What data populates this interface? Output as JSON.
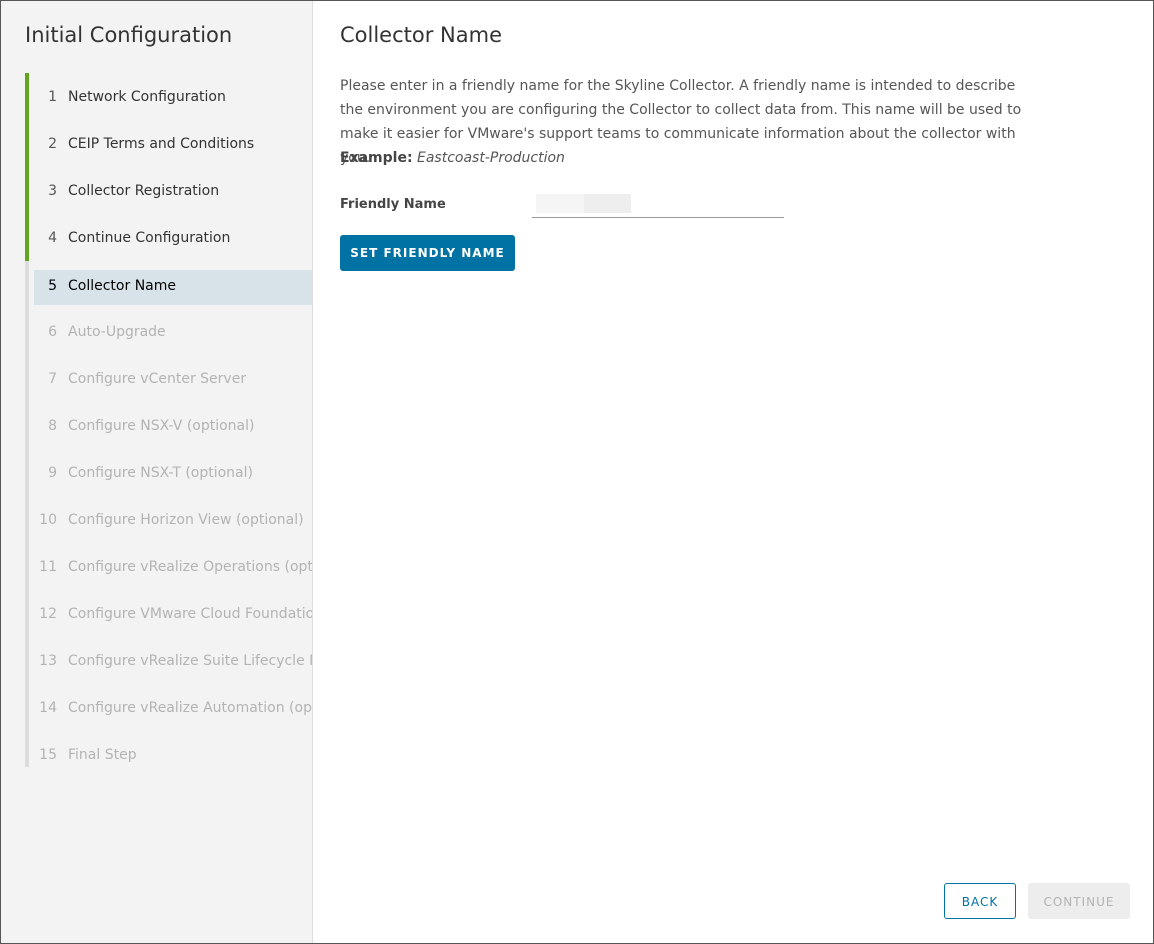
{
  "sidebar": {
    "title": "Initial Configuration",
    "steps": [
      {
        "num": "1",
        "label": "Network Configuration",
        "state": "done"
      },
      {
        "num": "2",
        "label": "CEIP Terms and Conditions",
        "state": "done"
      },
      {
        "num": "3",
        "label": "Collector Registration",
        "state": "done"
      },
      {
        "num": "4",
        "label": "Continue Configuration",
        "state": "done"
      },
      {
        "num": "5",
        "label": "Collector Name",
        "state": "active"
      },
      {
        "num": "6",
        "label": "Auto-Upgrade",
        "state": "pending"
      },
      {
        "num": "7",
        "label": "Configure vCenter Server",
        "state": "pending"
      },
      {
        "num": "8",
        "label": "Configure NSX-V (optional)",
        "state": "pending"
      },
      {
        "num": "9",
        "label": "Configure NSX-T (optional)",
        "state": "pending"
      },
      {
        "num": "10",
        "label": "Configure Horizon View (optional)",
        "state": "pending"
      },
      {
        "num": "11",
        "label": "Configure vRealize Operations (optio",
        "state": "pending"
      },
      {
        "num": "12",
        "label": "Configure VMware Cloud Foundation",
        "state": "pending"
      },
      {
        "num": "13",
        "label": "Configure vRealize Suite Lifecycle Ma",
        "state": "pending"
      },
      {
        "num": "14",
        "label": "Configure vRealize Automation (opti",
        "state": "pending"
      },
      {
        "num": "15",
        "label": "Final Step",
        "state": "pending"
      }
    ]
  },
  "main": {
    "title": "Collector Name",
    "description": "Please enter in a friendly name for the Skyline Collector. A friendly name is intended to describe the environment you are configuring the Collector to collect data from. This name will be used to make it easier for VMware's support teams to communicate information about the collector with you.",
    "example_label": "Example:",
    "example_value": "Eastcoast-Production",
    "field_label": "Friendly Name",
    "field_value": "",
    "set_button": "SET FRIENDLY NAME"
  },
  "footer": {
    "back_label": "BACK",
    "continue_label": "CONTINUE"
  },
  "colors": {
    "accent": "#0072a3",
    "done_bar": "#62a420",
    "active_highlight": "#d8e3e9"
  }
}
